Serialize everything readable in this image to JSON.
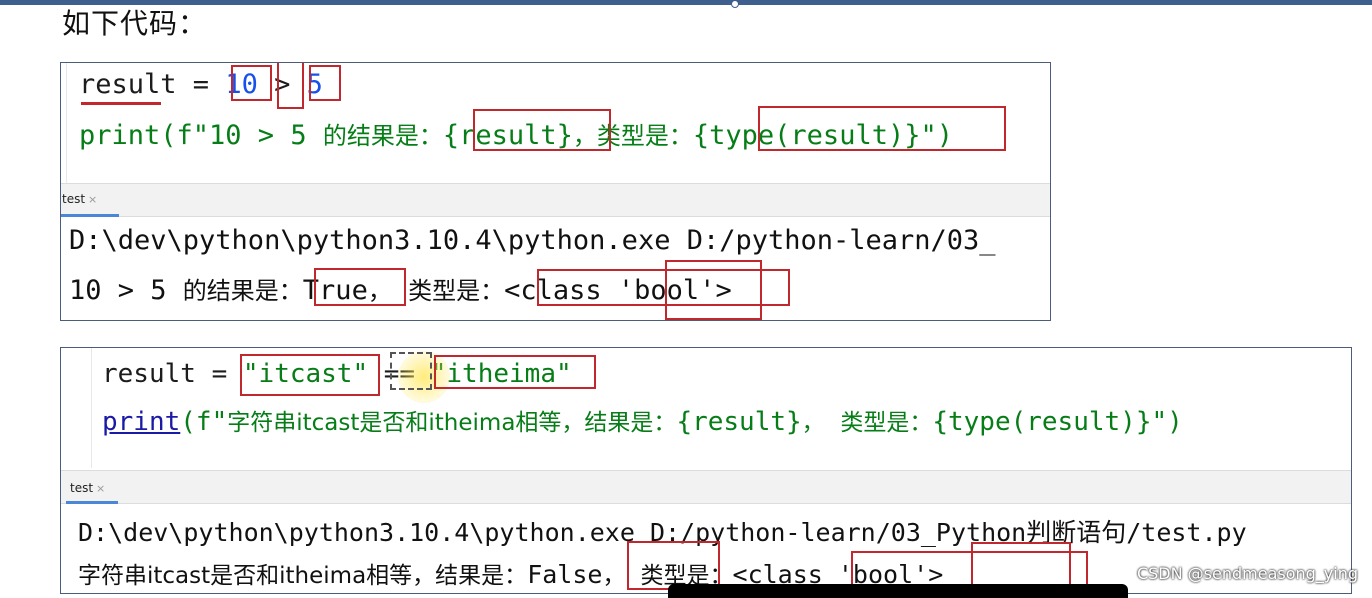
{
  "heading": "如下代码：",
  "example1": {
    "code": {
      "line1": {
        "var": "result",
        "eq": " = ",
        "left": "10",
        "op": ">",
        "right": "5"
      },
      "line2": {
        "pre": "print(f\"10 > 5 ",
        "label1": "的结果是：",
        "expr1": "{result}",
        "sep": "，",
        "label2": "类型是：",
        "expr2": "{type(result)}",
        "post": "\")"
      }
    },
    "run_tab": {
      "label": "test",
      "close": "×"
    },
    "output": {
      "line1": "D:\\dev\\python\\python3.10.4\\python.exe D:/python-learn/03_",
      "line2": {
        "pre": "10 > 5 ",
        "label1": "的结果是：",
        "value": "True",
        "sep": "，",
        "label2": "类型是：",
        "type_pre": "<class ",
        "type_name": "'bool'",
        "type_post": ">"
      }
    }
  },
  "example2": {
    "code": {
      "line1": {
        "var": "result",
        "eq": " = ",
        "left": "\"itcast\"",
        "op": "==",
        "right": "\"itheima\""
      },
      "line2": {
        "fn": "print",
        "pre": "(f\"",
        "text": "字符串itcast是否和itheima相等，结果是：",
        "expr1": "{result}",
        "sep": "，",
        "label2": "类型是：",
        "expr2": "{type(result)}",
        "post": "\")"
      }
    },
    "run_tab": {
      "label": "test",
      "close": "×"
    },
    "output": {
      "line1": "D:\\dev\\python\\python3.10.4\\python.exe D:/python-learn/03_Python判断语句/test.py",
      "line2": {
        "text": "字符串itcast是否和itheima相等，结果是：",
        "value": "False",
        "sep": "，",
        "label2": "类型是：",
        "type_pre": "<class ",
        "type_name": "'bool'",
        "type_post": ">"
      }
    }
  },
  "watermark": "CSDN @sendmeasong_ying",
  "colors": {
    "annotation": "#c0282e",
    "panel_border": "#4b5d7a",
    "tab_accent": "#4a87d6"
  }
}
